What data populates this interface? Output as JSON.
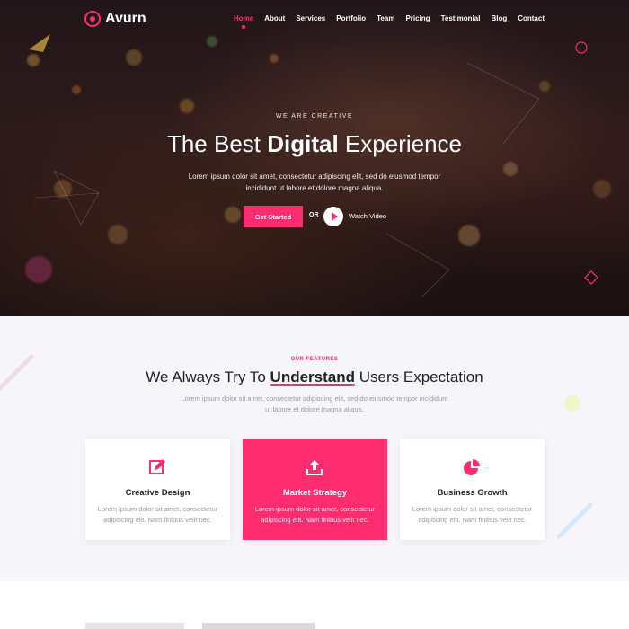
{
  "brand": {
    "name": "Avurn",
    "accent": "#ff2d6f"
  },
  "nav": {
    "items": [
      {
        "label": "Home",
        "active": true
      },
      {
        "label": "About"
      },
      {
        "label": "Services"
      },
      {
        "label": "Portfolio"
      },
      {
        "label": "Team"
      },
      {
        "label": "Pricing"
      },
      {
        "label": "Testimonial"
      },
      {
        "label": "Blog"
      },
      {
        "label": "Contact"
      }
    ]
  },
  "hero": {
    "kicker": "WE ARE CREATIVE",
    "title_pre": "The Best ",
    "title_highlight": "Digital",
    "title_post": " Experience",
    "description": "Lorem ipsum dolor sit amet, consectetur adipiscing elit, sed do eiusmod tempor incididunt ut labore et dolore magna aliqua.",
    "cta_label": "Get Started",
    "or_label": "OR",
    "video_label": "Watch Video"
  },
  "features": {
    "kicker": "OUR FEATURES",
    "title_pre": "We Always Try To ",
    "title_highlight": "Understand",
    "title_post": " Users Expectation",
    "description": "Lorem ipsum dolor sit amet, consectetur adipiscing elit, sed do eiusmod tempor incididunt ut labore et dolore magna aliqua.",
    "cards": [
      {
        "icon": "edit-icon",
        "title": "Creative Design",
        "text": "Lorem ipsum dolor sit amet, consectetur adipiscing elit. Nam finibus velit nec."
      },
      {
        "icon": "upload-icon",
        "title": "Market Strategy",
        "text": "Lorem ipsum dolor sit amet, consectetur adipiscing elit. Nam finibus velit nec.",
        "highlighted": true
      },
      {
        "icon": "pie-chart-icon",
        "title": "Business Growth",
        "text": "Lorem ipsum dolor sit amet, consectetur adipiscing elit. Nam finibus velit nec."
      }
    ]
  }
}
